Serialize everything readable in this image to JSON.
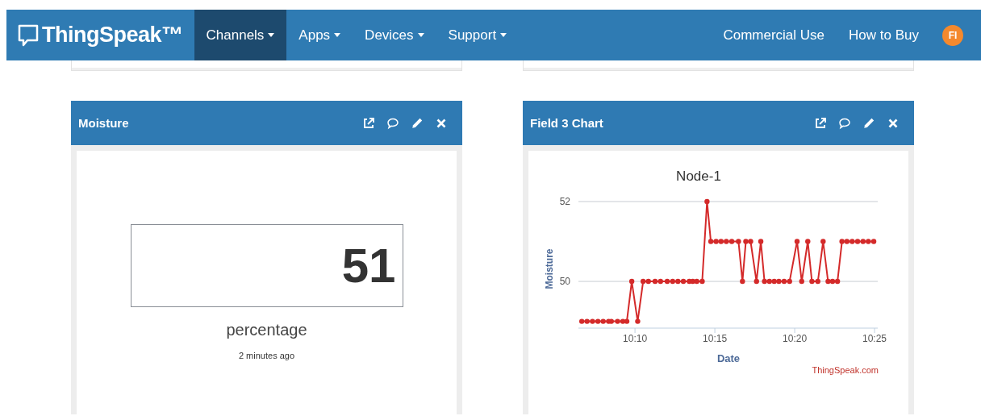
{
  "nav": {
    "logo": "ThingSpeak™",
    "menus": [
      {
        "label": "Channels",
        "selected": true
      },
      {
        "label": "Apps",
        "selected": false
      },
      {
        "label": "Devices",
        "selected": false
      },
      {
        "label": "Support",
        "selected": false
      }
    ],
    "links": [
      "Commercial Use",
      "How to Buy"
    ],
    "avatar": "FI"
  },
  "cards": [
    {
      "kind": "display",
      "title": "Moisture",
      "value": "51",
      "unit": "percentage",
      "updated": "2 minutes ago"
    },
    {
      "kind": "chart",
      "title": "Field 3 Chart",
      "credit": "ThingSpeak.com",
      "chart_data": {
        "type": "line",
        "title": "Node-1",
        "xlabel": "Date",
        "ylabel": "Moisture",
        "x": [
          606.67,
          607.0,
          607.34,
          607.68,
          608.01,
          608.35,
          608.52,
          608.91,
          609.24,
          609.49,
          609.8,
          610.17,
          610.51,
          610.84,
          611.26,
          611.6,
          612.02,
          612.36,
          612.69,
          613.03,
          613.4,
          613.62,
          613.87,
          614.21,
          614.51,
          614.75,
          615.08,
          615.39,
          615.72,
          616.06,
          616.48,
          616.73,
          616.94,
          617.24,
          617.61,
          617.88,
          618.11,
          618.42,
          618.72,
          619.01,
          619.34,
          619.68,
          620.15,
          620.44,
          620.82,
          621.08,
          621.45,
          621.78,
          622.09,
          622.37,
          622.68,
          622.96,
          623.27,
          623.6,
          623.94,
          624.28,
          624.61,
          624.95
        ],
        "series": [
          {
            "color": "#d42a2a",
            "marker": true,
            "values": [
              49,
              49,
              49,
              49,
              49,
              49,
              49,
              49,
              49,
              49,
              50,
              49,
              50,
              50,
              50,
              50,
              50,
              50,
              50,
              50,
              50,
              50,
              50,
              50,
              52,
              51,
              51,
              51,
              51,
              51,
              51,
              50,
              51,
              51,
              50,
              51,
              50,
              50,
              50,
              50,
              50,
              50,
              51,
              50,
              51,
              50,
              50,
              51,
              50,
              50,
              50,
              51,
              51,
              51,
              51,
              51,
              51,
              51
            ]
          }
        ],
        "xlim": [
          606.46,
          625.2
        ],
        "ylim": [
          48.83,
          52
        ],
        "yticks": [
          50,
          52
        ],
        "xticks": [
          {
            "value": 610,
            "label": "10:10"
          },
          {
            "value": 615,
            "label": "10:15"
          },
          {
            "value": 620,
            "label": "10:20"
          },
          {
            "value": 625,
            "label": "10:25"
          }
        ]
      }
    }
  ]
}
